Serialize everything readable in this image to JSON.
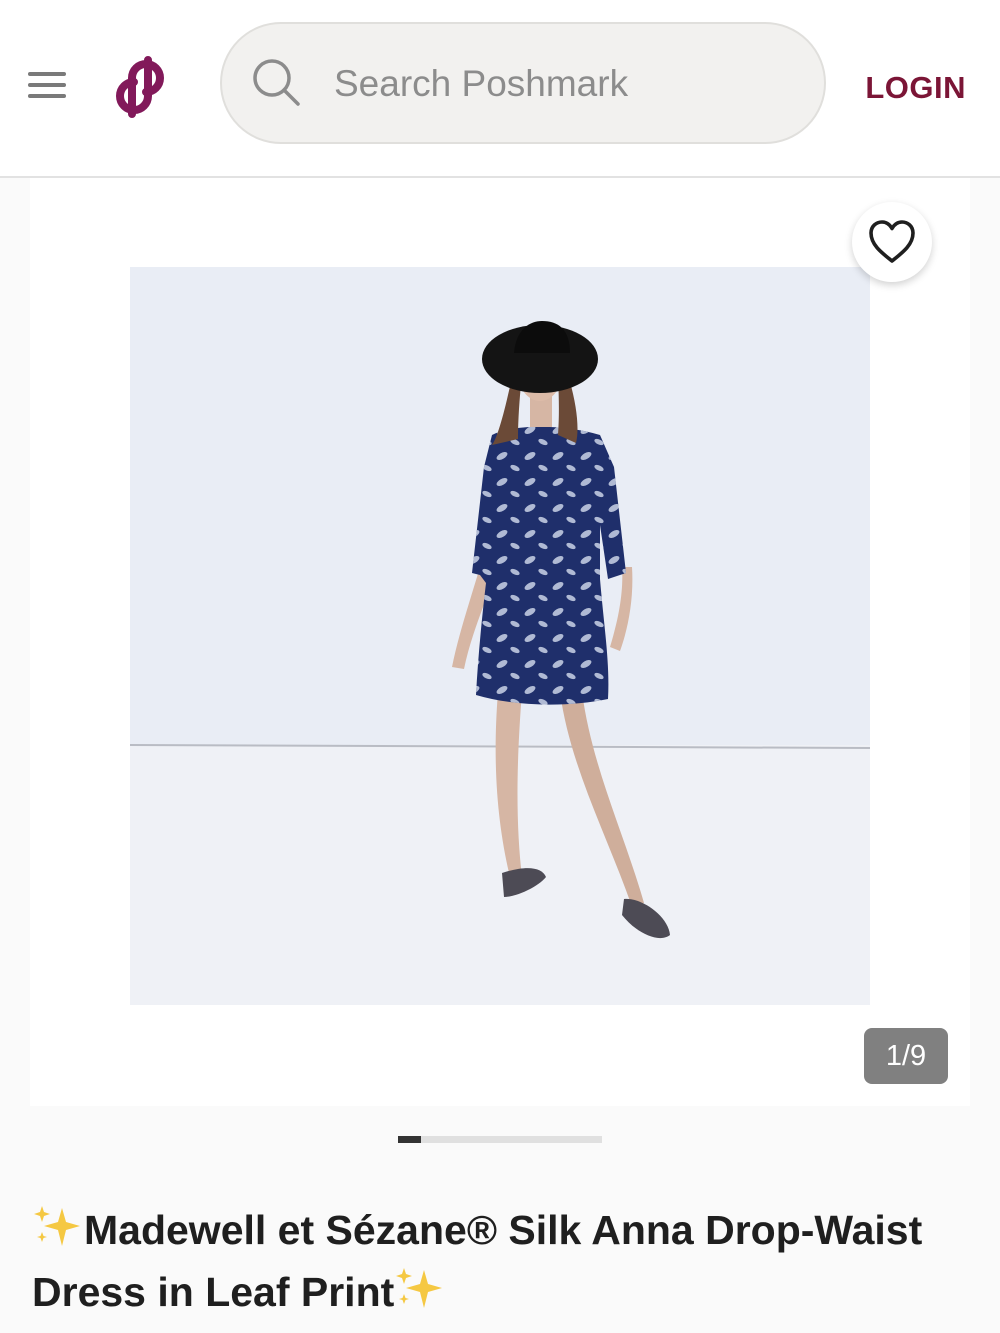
{
  "header": {
    "menu_icon": "hamburger-menu-icon",
    "logo_icon": "poshmark-logo-icon",
    "search": {
      "placeholder": "Search Poshmark",
      "value": "",
      "icon": "search-icon"
    },
    "login_label": "LOGIN"
  },
  "gallery": {
    "like_icon": "heart-outline-icon",
    "counter_text": "1/9",
    "current_index": 1,
    "total": 9,
    "progress_fraction": 0.111
  },
  "listing": {
    "title_part1": "Madewell et Sézane® Silk Anna Drop-Waist Dress in Leaf Print",
    "sparkle_icon": "sparkles-icon"
  },
  "colors": {
    "brand": "#7b1536",
    "logo": "#82195a",
    "sparkle": "#f5c842"
  }
}
